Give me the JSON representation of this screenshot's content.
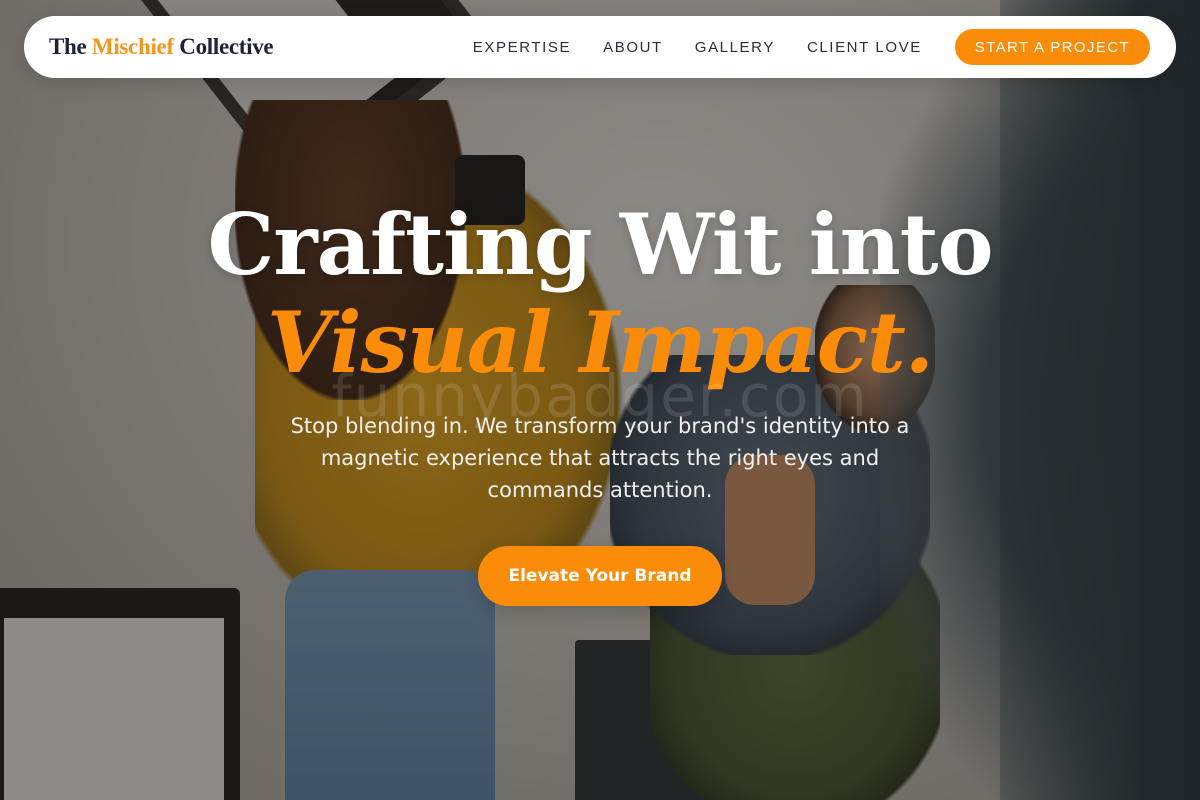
{
  "brand": {
    "part1": "The ",
    "part2": "Mischief",
    "part3": " Collective"
  },
  "nav": {
    "items": [
      {
        "label": "EXPERTISE"
      },
      {
        "label": "ABOUT"
      },
      {
        "label": "GALLERY"
      },
      {
        "label": "CLIENT LOVE"
      }
    ],
    "cta_label": "START A PROJECT"
  },
  "hero": {
    "headline_line1": "Crafting Wit into",
    "headline_line2": "Visual Impact.",
    "subtext": "Stop blending in. We transform your brand's identity into a magnetic experience that attracts the right eyes and commands attention.",
    "cta_label": "Elevate Your Brand",
    "watermark": "funnybadger.com"
  },
  "colors": {
    "accent": "#fb8c0a",
    "brand_dark": "#1d2238",
    "nav_background": "#ffffff"
  }
}
